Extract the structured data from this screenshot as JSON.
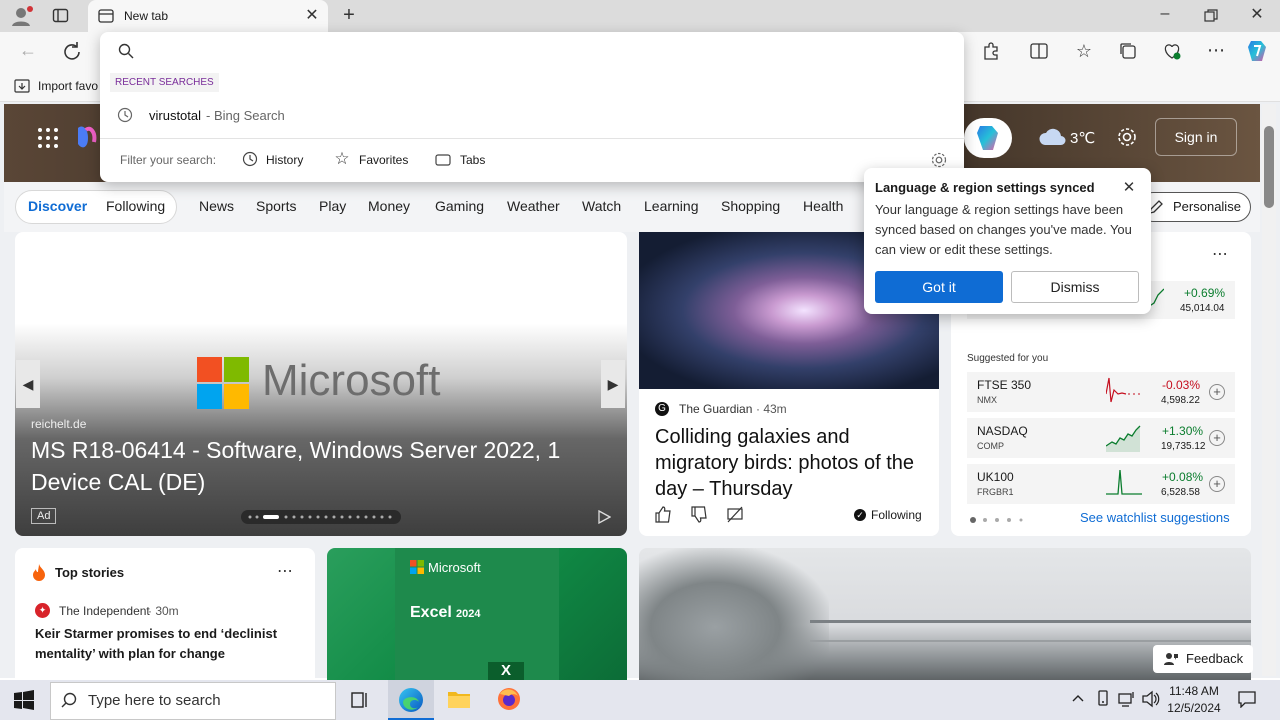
{
  "browser": {
    "tab_title": "New tab",
    "favorites_bar": {
      "import_label": "Import favo"
    }
  },
  "address_popup": {
    "section_label": "RECENT SEARCHES",
    "recent": [
      {
        "query": "virustotal",
        "source": " - Bing Search"
      }
    ],
    "filter_label": "Filter your search:",
    "filters": [
      "History",
      "Favorites",
      "Tabs"
    ]
  },
  "header": {
    "weather_temp": "3℃",
    "sign_in": "Sign in"
  },
  "nav": {
    "discover": "Discover",
    "following": "Following",
    "items": [
      "News",
      "Sports",
      "Play",
      "Money",
      "Gaming",
      "Weather",
      "Watch",
      "Learning",
      "Shopping",
      "Health"
    ],
    "personalise": "Personalise"
  },
  "carousel": {
    "brand": "Microsoft",
    "source": "reichelt.de",
    "title": "MS R18-06414 - Software, Windows Server 2022, 1 Device CAL (DE)",
    "ad_label": "Ad"
  },
  "article": {
    "source": "The Guardian",
    "time": "· 43m",
    "title": "Colliding galaxies and migratory birds: photos of the day – Thursday",
    "following_label": "Following"
  },
  "toast": {
    "title": "Language & region settings synced",
    "body": "Your language & region settings have been synced based on changes you've made. You can view or edit these settings.",
    "got_it": "Got it",
    "dismiss": "Dismiss"
  },
  "watchlist": {
    "top": {
      "change": "+0.69%",
      "value": "45,014.04"
    },
    "suggested_label": "Suggested for you",
    "suggestions": [
      {
        "name": "FTSE 350",
        "code": "NMX",
        "change": "-0.03%",
        "value": "4,598.22",
        "dir": "neg"
      },
      {
        "name": "NASDAQ",
        "code": "COMP",
        "change": "+1.30%",
        "value": "19,735.12",
        "dir": "pos"
      },
      {
        "name": "UK100",
        "code": "FRGBR1",
        "change": "+0.08%",
        "value": "6,528.58",
        "dir": "pos"
      }
    ],
    "see_suggestions": "See watchlist suggestions"
  },
  "top_stories": {
    "heading": "Top stories",
    "source": "The Independent",
    "time": "· 30m",
    "title": "Keir Starmer promises to end ‘declinist mentality’ with plan for change"
  },
  "excel_card": {
    "brand": "Microsoft",
    "product": "Excel",
    "year": "2024"
  },
  "feedback": "Feedback",
  "taskbar": {
    "search_placeholder": "Type here to search",
    "time": "11:48 AM",
    "date": "12/5/2024"
  },
  "colors": {
    "accent": "#0f6cd4",
    "positive": "#0b7d2e",
    "negative": "#c50f1f",
    "excel_green": "#107c41"
  }
}
